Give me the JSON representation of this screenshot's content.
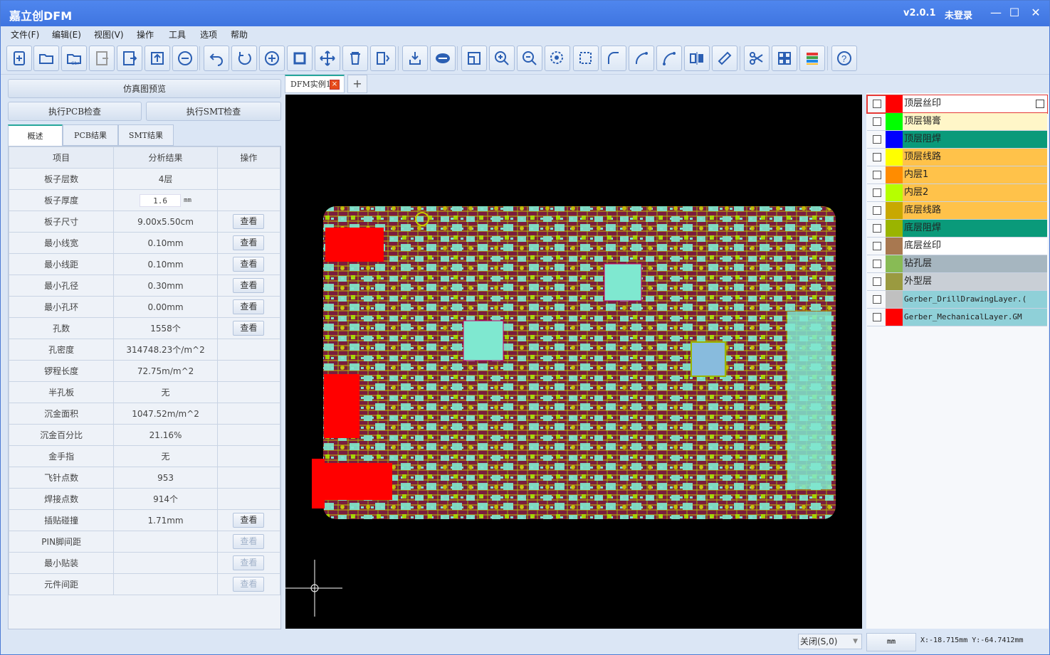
{
  "window": {
    "title": "嘉立创DFM",
    "version": "v2.0.1",
    "login_status": "未登录"
  },
  "menu": [
    "文件(F)",
    "编辑(E)",
    "视图(V)",
    "操作",
    "工具",
    "选项",
    "帮助"
  ],
  "toolbar_icons": [
    "new-file-icon",
    "open-folder-icon",
    "open-gbr-icon",
    "gbr-export-icon",
    "odb-export-icon",
    "upload-icon",
    "remove-icon",
    "undo-icon",
    "redo-icon",
    "add-circle-icon",
    "square-icon",
    "move-icon",
    "delete-icon",
    "mirror-icon",
    "import-icon",
    "3d-view-icon",
    "fit-view-icon",
    "zoom-in-icon",
    "zoom-out-icon",
    "zoom-target-icon",
    "select-area-icon",
    "arc-icon",
    "arc-2-icon",
    "arc-3-icon",
    "align-icon",
    "ruler-icon",
    "cut-icon",
    "grid-icon",
    "layers-icon",
    "help-icon"
  ],
  "left": {
    "sim_preview": "仿真图预览",
    "run_pcb": "执行PCB检查",
    "run_smt": "执行SMT检查",
    "tabs": [
      "概述",
      "PCB结果",
      "SMT结果"
    ],
    "headers": [
      "项目",
      "分析结果",
      "操作"
    ],
    "thickness": {
      "value": "1.6",
      "unit": "mm"
    },
    "view_label": "查看",
    "rows": [
      {
        "item": "板子层数",
        "result": "4层",
        "action": ""
      },
      {
        "item": "板子厚度",
        "result": "",
        "action": "thickness"
      },
      {
        "item": "板子尺寸",
        "result": "9.00x5.50cm",
        "action": "view"
      },
      {
        "item": "最小线宽",
        "result": "0.10mm",
        "action": "view"
      },
      {
        "item": "最小线距",
        "result": "0.10mm",
        "action": "view"
      },
      {
        "item": "最小孔径",
        "result": "0.30mm",
        "action": "view"
      },
      {
        "item": "最小孔环",
        "result": "0.00mm",
        "action": "view"
      },
      {
        "item": "孔数",
        "result": "1558个",
        "action": "view"
      },
      {
        "item": "孔密度",
        "result": "314748.23个/m^2",
        "action": ""
      },
      {
        "item": "锣程长度",
        "result": "72.75m/m^2",
        "action": ""
      },
      {
        "item": "半孔板",
        "result": "无",
        "action": ""
      },
      {
        "item": "沉金面积",
        "result": "1047.52m/m^2",
        "action": ""
      },
      {
        "item": "沉金百分比",
        "result": "21.16%",
        "action": ""
      },
      {
        "item": "金手指",
        "result": "无",
        "action": ""
      },
      {
        "item": "飞针点数",
        "result": "953",
        "action": ""
      },
      {
        "item": "焊接点数",
        "result": "914个",
        "action": ""
      },
      {
        "item": "插贴碰撞",
        "result": "1.71mm",
        "action": "view"
      },
      {
        "item": "PIN脚间距",
        "result": "",
        "action": "view-disabled"
      },
      {
        "item": "最小贴装",
        "result": "",
        "action": "view-disabled"
      },
      {
        "item": "元件间距",
        "result": "",
        "action": "view-disabled"
      }
    ]
  },
  "document_tab": {
    "label": "DFM实例1",
    "close": "×",
    "add": "+"
  },
  "layers": [
    {
      "name": "顶层丝印",
      "color": "#ff0000",
      "bg": "#ffffff"
    },
    {
      "name": "顶层锡膏",
      "color": "#00ff00",
      "bg": "#fff6c8"
    },
    {
      "name": "顶层阻焊",
      "color": "#0000ff",
      "bg": "#0a9a7a"
    },
    {
      "name": "顶层线路",
      "color": "#ffff00",
      "bg": "#ffc24a"
    },
    {
      "name": "内层1",
      "color": "#ff8c00",
      "bg": "#ffc24a"
    },
    {
      "name": "内层2",
      "color": "#b6ff00",
      "bg": "#ffc24a"
    },
    {
      "name": "底层线路",
      "color": "#c8a800",
      "bg": "#ffc24a"
    },
    {
      "name": "底层阻焊",
      "color": "#9ab400",
      "bg": "#0a9a7a"
    },
    {
      "name": "底层丝印",
      "color": "#a87850",
      "bg": "#ffffff"
    },
    {
      "name": "钻孔层",
      "color": "#88bb55",
      "bg": "#a6b6c0"
    },
    {
      "name": "外型层",
      "color": "#9a9a40",
      "bg": "#c9cfd6"
    },
    {
      "name": "Gerber_DrillDrawingLayer.(",
      "color": "#c0c0c0",
      "bg": "#8fd0d8"
    },
    {
      "name": "Gerber_MechanicalLayer.GM",
      "color": "#ff0000",
      "bg": "#8fd0d8"
    }
  ],
  "status": {
    "snap": "关闭(S,0)",
    "unit": "mm",
    "coords": "X:-18.715mm Y:-64.7412mm"
  }
}
